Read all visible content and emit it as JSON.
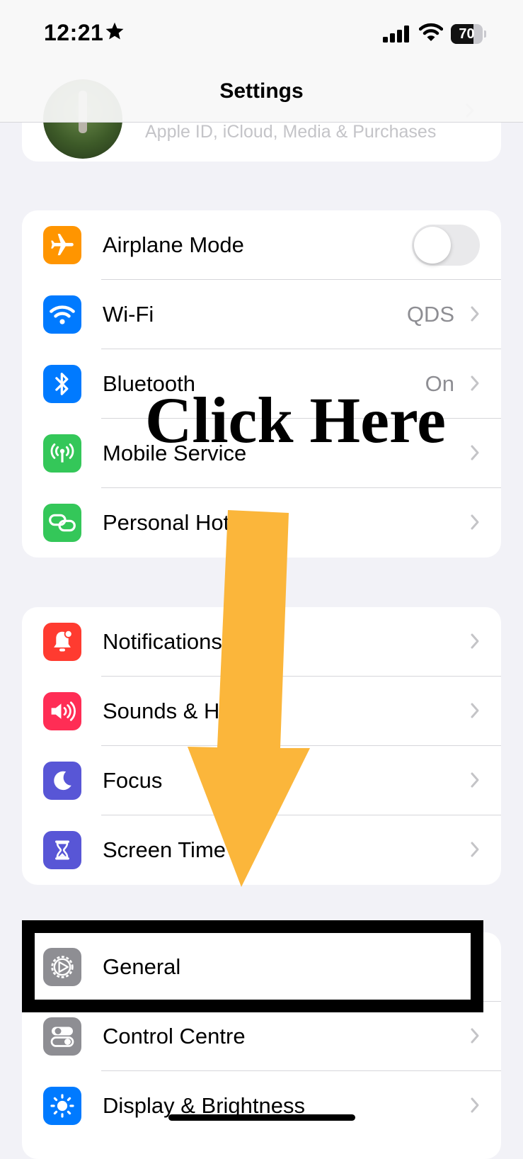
{
  "status_bar": {
    "time": "12:21",
    "battery": "70",
    "battery_level": 0.7
  },
  "nav": {
    "title": "Settings"
  },
  "profile": {
    "subtitle": "Apple ID, iCloud, Media & Purchases"
  },
  "groups": {
    "connectivity": [
      {
        "label": "Airplane Mode",
        "icon": "airplane-icon",
        "color": "#ff9500",
        "toggle": false
      },
      {
        "label": "Wi-Fi",
        "value": "QDS",
        "icon": "wifi-icon",
        "color": "#007aff"
      },
      {
        "label": "Bluetooth",
        "value": "On",
        "icon": "bluetooth-icon",
        "color": "#007aff"
      },
      {
        "label": "Mobile Service",
        "icon": "antenna-icon",
        "color": "#34c759"
      },
      {
        "label": "Personal Hotspot",
        "icon": "hotspot-link-icon",
        "color": "#34c759"
      }
    ],
    "notifications": [
      {
        "label": "Notifications",
        "icon": "bell-icon",
        "color": "#ff3b30"
      },
      {
        "label": "Sounds & Haptics",
        "icon": "speaker-icon",
        "color": "#ff2d55"
      },
      {
        "label": "Focus",
        "icon": "moon-icon",
        "color": "#5856d6"
      },
      {
        "label": "Screen Time",
        "icon": "hourglass-icon",
        "color": "#5856d6"
      }
    ],
    "general": [
      {
        "label": "General",
        "icon": "gear-icon",
        "color": "#8e8e93"
      },
      {
        "label": "Control Centre",
        "icon": "toggles-icon",
        "color": "#8e8e93"
      },
      {
        "label": "Display & Brightness",
        "icon": "sun-icon",
        "color": "#007aff"
      }
    ]
  },
  "annotation": {
    "text": "Click Here",
    "arrow_color": "#fbb63b",
    "box_color": "#000000"
  }
}
